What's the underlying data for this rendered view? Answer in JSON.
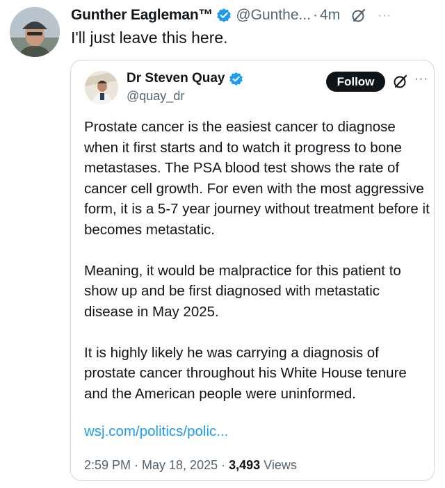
{
  "outer_tweet": {
    "author_name": "Gunther Eagleman™",
    "handle": "@Gunthe...",
    "separator": "·",
    "time": "4m",
    "text": "I'll just leave this here.",
    "more": "···"
  },
  "quoted_tweet": {
    "author_name": "Dr Steven Quay",
    "handle": "@quay_dr",
    "follow_label": "Follow",
    "more": "···",
    "paragraphs": [
      "Prostate cancer is the easiest cancer to diagnose when it first starts and to watch it progress to bone metastases. The PSA blood test shows the rate of cancer cell growth. For even with the most aggressive form, it is a 5-7 year journey without treatment before it becomes metastatic.",
      "Meaning, it would be malpractice for this patient to show up and be first diagnosed with metastatic disease in May 2025.",
      "It is highly likely he was carrying a diagnosis of prostate cancer throughout his White House tenure and the American people were uninformed."
    ],
    "link_text": "wsj.com/politics/polic...",
    "timestamp": "2:59 PM · May 18, 2025 · ",
    "views_count": "3,493",
    "views_label": " Views"
  },
  "colors": {
    "verified_badge": "#1d9bf0",
    "link": "#1d9bf0",
    "secondary_text": "#536471",
    "follow_button_bg": "#0f1419"
  },
  "icons": [
    "verified-badge-icon",
    "grok-icon",
    "more-options-icon"
  ]
}
